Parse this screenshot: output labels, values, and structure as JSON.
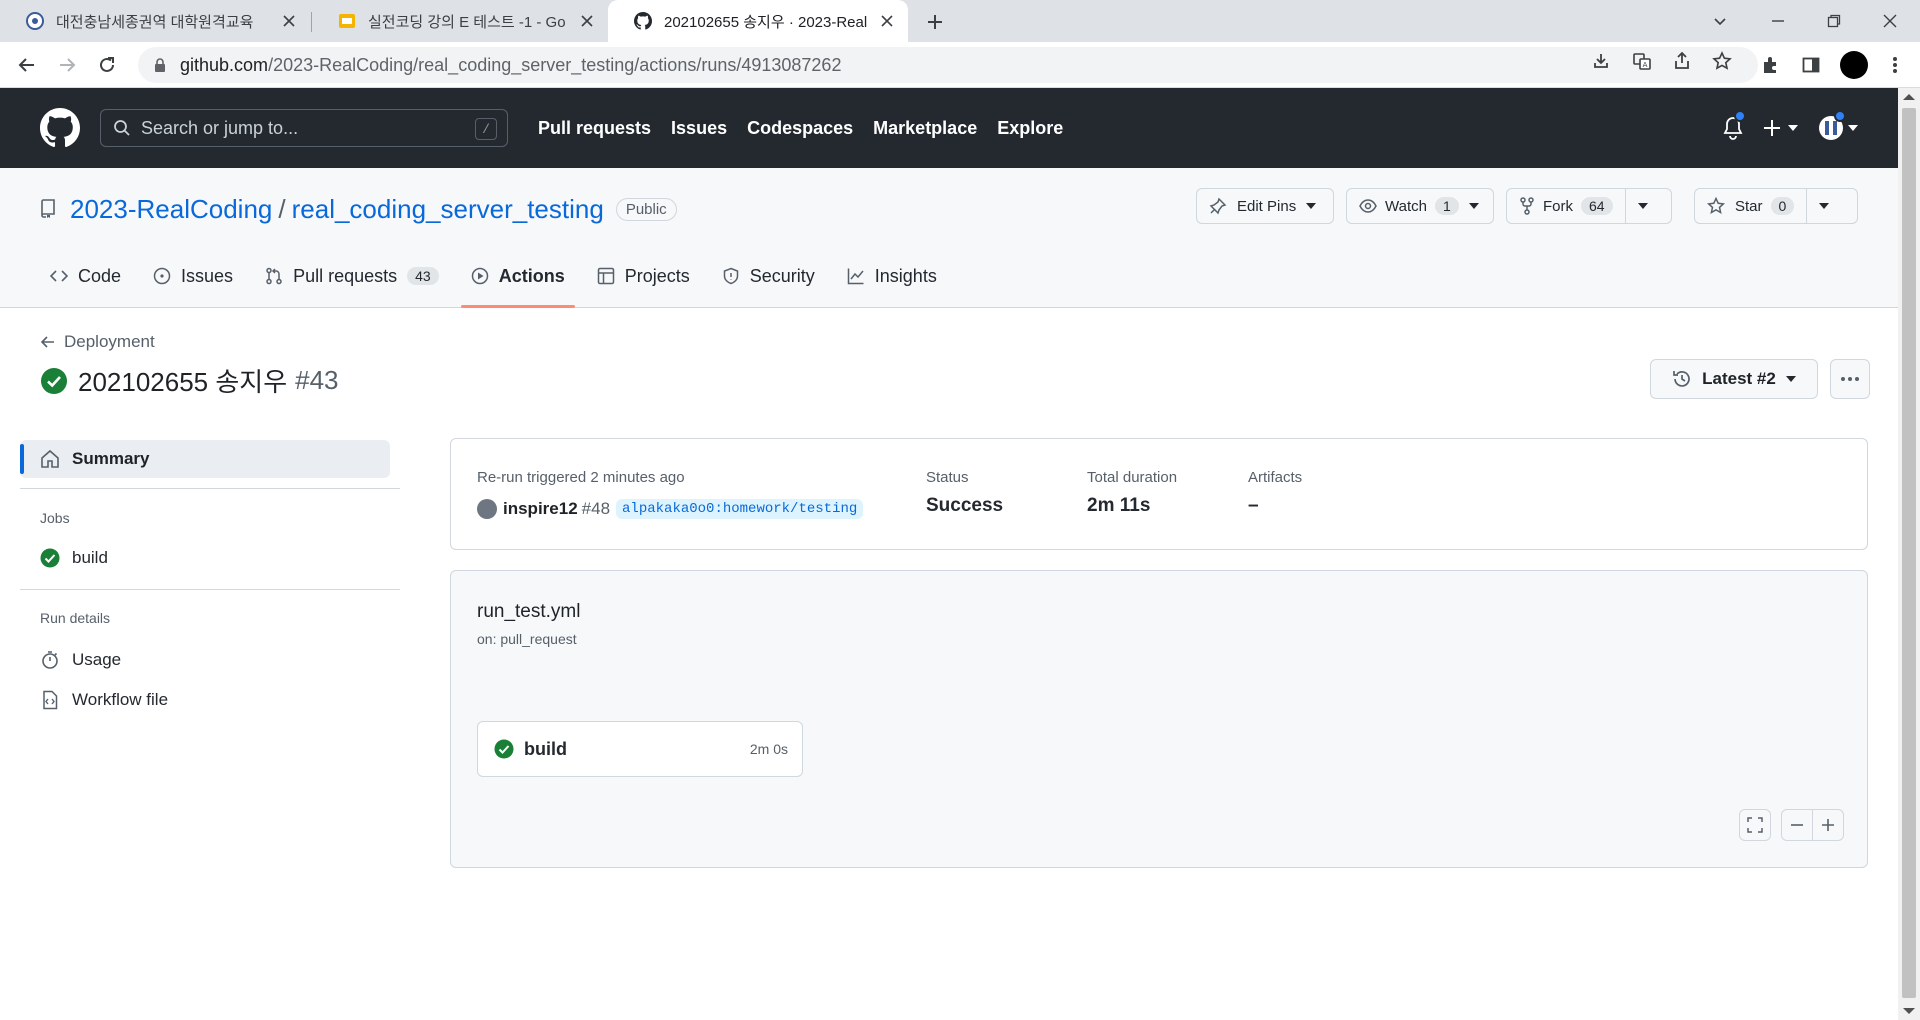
{
  "browser": {
    "tabs": [
      {
        "title": "대전충남세종권역 대학원격교육",
        "icon": "university-favicon"
      },
      {
        "title": "실전코딩 강의 E 테스트 -1 - Go",
        "icon": "slides-favicon"
      },
      {
        "title": "202102655 송지우 · 2023-RealC",
        "icon": "github-favicon"
      }
    ],
    "url_host": "github.com",
    "url_path": "/2023-RealCoding/real_coding_server_testing/actions/runs/4913087262"
  },
  "github": {
    "search_placeholder": "Search or jump to...",
    "search_shortcut": "/",
    "nav": [
      "Pull requests",
      "Issues",
      "Codespaces",
      "Marketplace",
      "Explore"
    ]
  },
  "repo": {
    "owner": "2023-RealCoding",
    "separator": "/",
    "name": "real_coding_server_testing",
    "visibility": "Public",
    "edit_pins": "Edit Pins",
    "watch": {
      "label": "Watch",
      "count": "1"
    },
    "fork": {
      "label": "Fork",
      "count": "64"
    },
    "star": {
      "label": "Star",
      "count": "0"
    },
    "tabs": [
      {
        "label": "Code"
      },
      {
        "label": "Issues"
      },
      {
        "label": "Pull requests",
        "count": "43"
      },
      {
        "label": "Actions"
      },
      {
        "label": "Projects"
      },
      {
        "label": "Security"
      },
      {
        "label": "Insights"
      }
    ]
  },
  "run": {
    "back_label": "Deployment",
    "title": "202102655 송지우",
    "number": "#43",
    "attempt_label": "Latest #2"
  },
  "sidebar": {
    "summary": "Summary",
    "jobs_heading": "Jobs",
    "job": "build",
    "details_heading": "Run details",
    "usage": "Usage",
    "workflow_file": "Workflow file"
  },
  "summary": {
    "trigger_label": "Re-run triggered 2 minutes ago",
    "actor": "inspire12",
    "pr": "#48",
    "branch": "alpakaka0o0:homework/testing",
    "status_label": "Status",
    "status_value": "Success",
    "duration_label": "Total duration",
    "duration_value": "2m 11s",
    "artifacts_label": "Artifacts",
    "artifacts_value": "–"
  },
  "workflow": {
    "file": "run_test.yml",
    "trigger": "on: pull_request",
    "job_name": "build",
    "job_duration": "2m 0s"
  },
  "colors": {
    "header_bg": "#24292f",
    "accent_link": "#0969da",
    "success": "#1a7f37",
    "active_tab_underline": "#fd8c73"
  }
}
